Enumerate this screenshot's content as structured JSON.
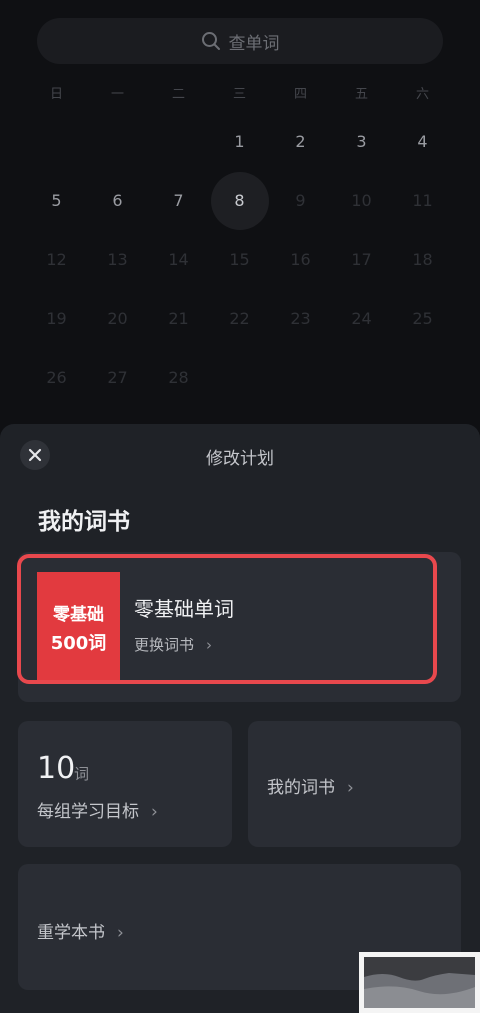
{
  "search": {
    "placeholder": "查单词"
  },
  "calendar": {
    "weekdays": [
      "日",
      "一",
      "二",
      "三",
      "四",
      "五",
      "六"
    ],
    "leading_blanks": 3,
    "days": [
      "1",
      "2",
      "3",
      "4",
      "5",
      "6",
      "7",
      "8",
      "9",
      "10",
      "11",
      "12",
      "13",
      "14",
      "15",
      "16",
      "17",
      "18",
      "19",
      "20",
      "21",
      "22",
      "23",
      "24",
      "25",
      "26",
      "27",
      "28"
    ],
    "active_until": 8,
    "today": 8
  },
  "sheet": {
    "title": "修改计划",
    "section_title": "我的词书",
    "book": {
      "cover_line1": "零基础",
      "cover_line2": "500词",
      "name": "零基础单词",
      "change_label": "更换词书"
    },
    "goal": {
      "value": "10",
      "unit": "词",
      "label": "每组学习目标"
    },
    "my_books_label": "我的词书",
    "relearn_label": "重学本书",
    "chevron": "›"
  },
  "colors": {
    "highlight": "#e8484d",
    "cover": "#e23a3f",
    "sheet_bg": "#1f2227",
    "card_bg": "#2a2d34"
  }
}
